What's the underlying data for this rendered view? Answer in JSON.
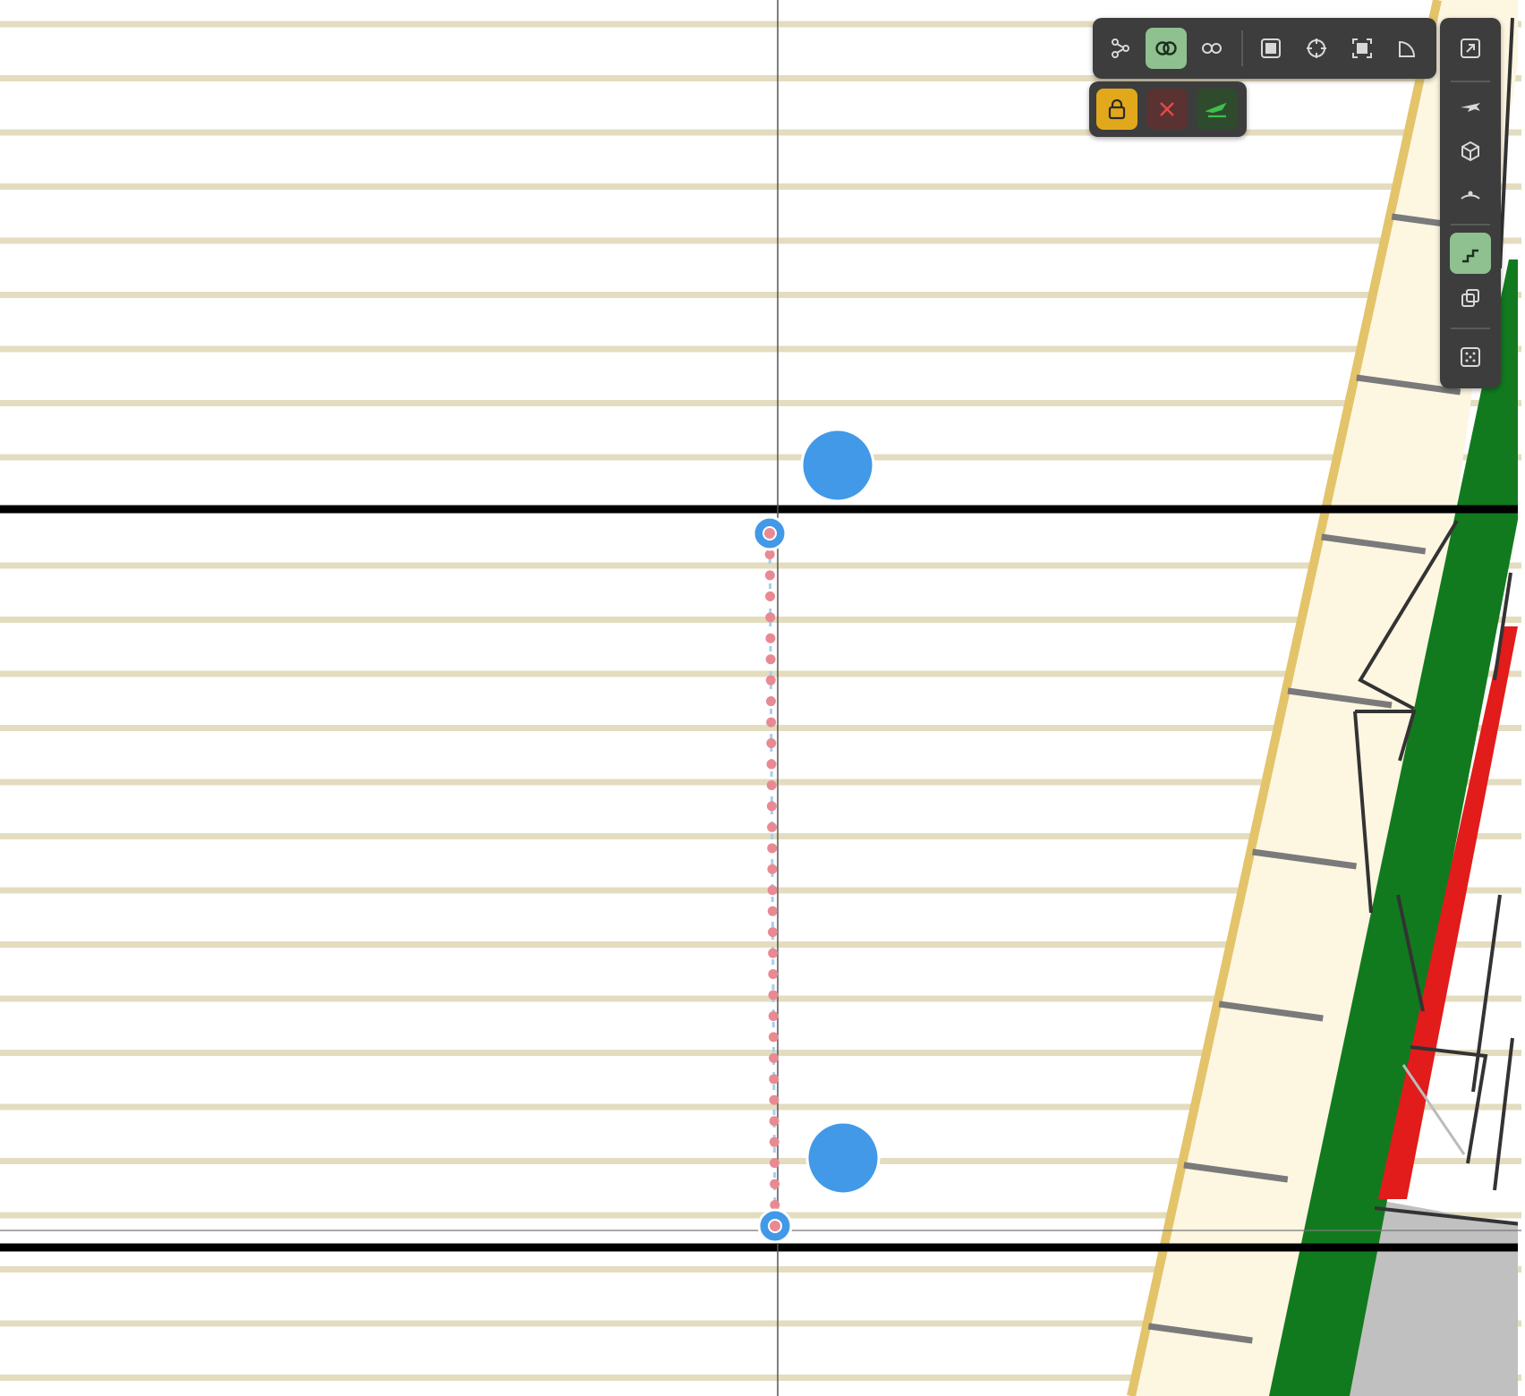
{
  "viewport": {
    "colors": {
      "background": "#ffffff",
      "stripe": "#e3dcbf",
      "bold_line": "#000000",
      "cursor_line": "#555555",
      "handle": "#4299e8",
      "dotted_path": "#e98a93",
      "cream_band": "#fdf6e1",
      "gold_edge": "#e3c46a",
      "green_band": "#127a1e",
      "red_band": "#e21b1b",
      "gray_zone": "#c0c0c0",
      "dark_mesh": "#333333",
      "gray_ticks": "#7a7a7a"
    }
  },
  "toolbar_top": {
    "buttons": [
      {
        "icon": "graph-nodes-icon",
        "active": false
      },
      {
        "icon": "intersect-rings-icon",
        "active": true
      },
      {
        "icon": "chain-link-icon",
        "active": false
      },
      {
        "icon": "square-frame-icon",
        "active": false
      },
      {
        "icon": "crosshair-target-icon",
        "active": false
      },
      {
        "icon": "focus-frame-icon",
        "active": false
      },
      {
        "icon": "quarter-arc-icon",
        "active": false
      }
    ]
  },
  "toolbar_actions": {
    "buttons": [
      {
        "icon": "lock-icon",
        "bg": "#e2a81b"
      },
      {
        "icon": "close-icon",
        "bg": "#5a3232"
      },
      {
        "icon": "plane-takeoff-icon",
        "bg": "#2e4b2e"
      }
    ]
  },
  "toolbar_side": {
    "buttons": [
      {
        "icon": "expand-icon",
        "active": false
      },
      {
        "icon": "plane-icon",
        "active": false
      },
      {
        "icon": "cube-icon",
        "active": false
      },
      {
        "icon": "arc-curve-icon",
        "active": false
      },
      {
        "icon": "stairs-icon",
        "active": true
      },
      {
        "icon": "layers-copy-icon",
        "active": false
      },
      {
        "icon": "grid-dots-icon",
        "active": false
      }
    ]
  }
}
